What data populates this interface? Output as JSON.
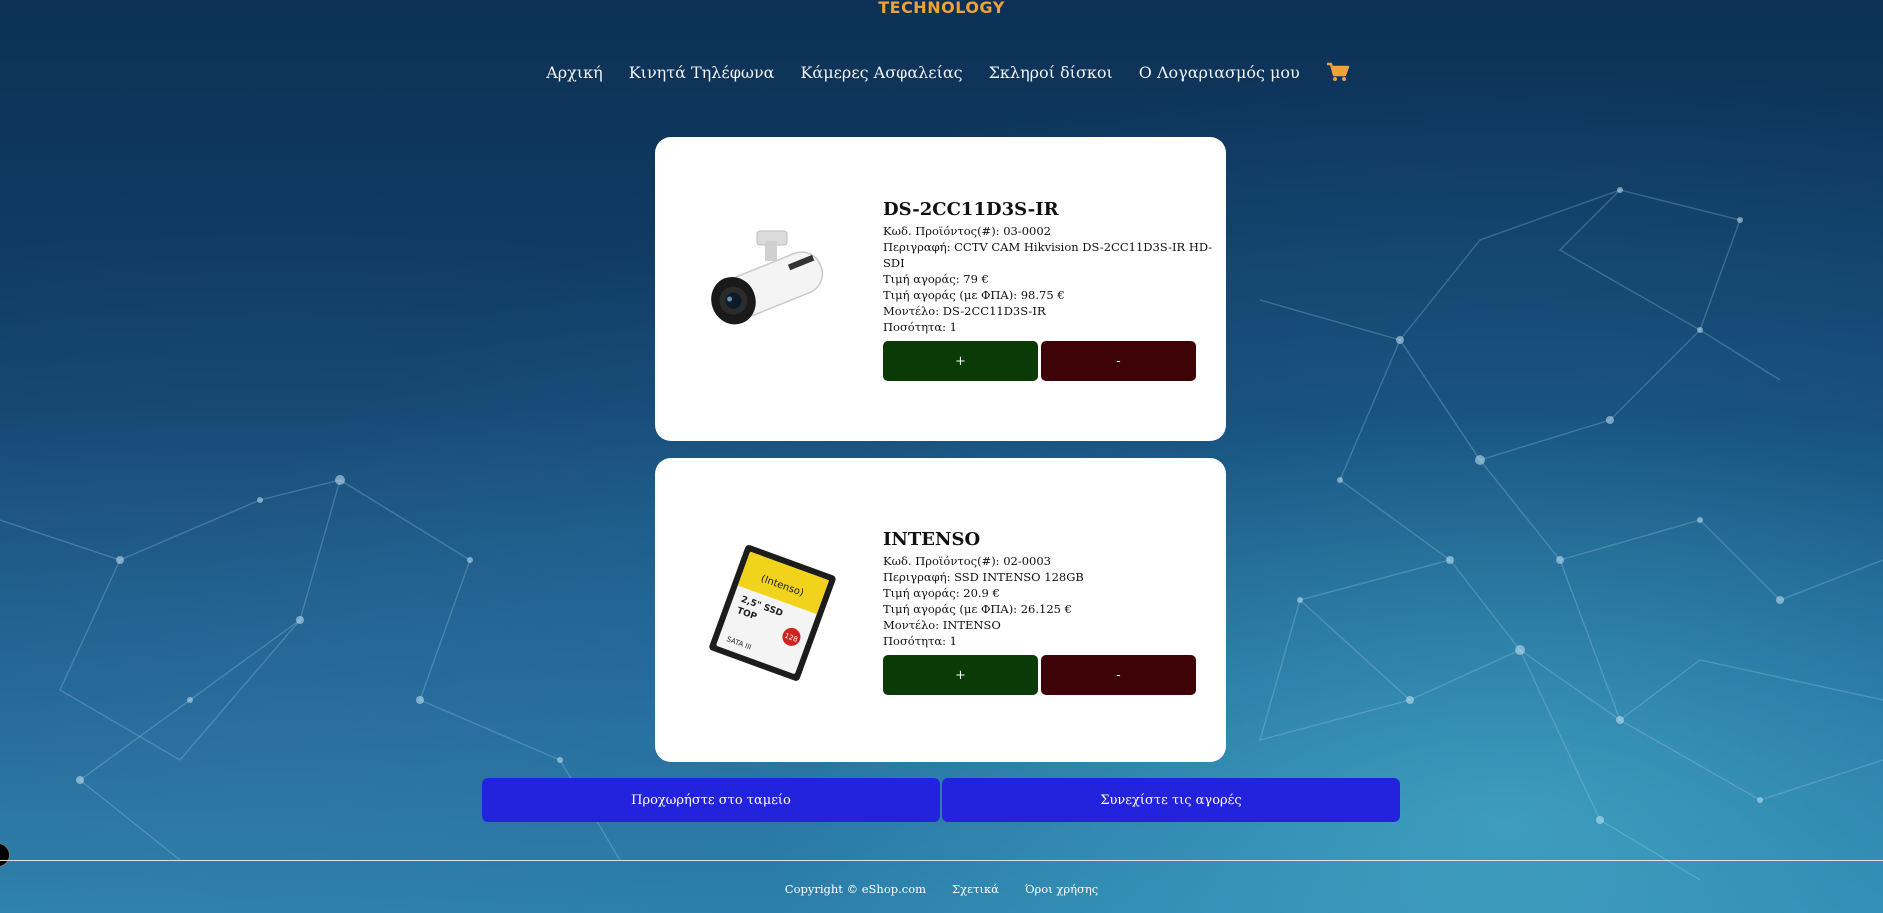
{
  "brand": {
    "logo_text": "TECHNOLOGY"
  },
  "nav": {
    "items": [
      {
        "label": "Αρχική"
      },
      {
        "label": "Κινητά Τηλέφωνα"
      },
      {
        "label": "Κάμερες Ασφαλείας"
      },
      {
        "label": "Σκληροί δίσκοι"
      },
      {
        "label": "Ο Λογαριασμός μου"
      }
    ],
    "cart_icon": "shopping-cart-icon",
    "accent": "#f0a13a"
  },
  "cart": {
    "items": [
      {
        "title": "DS-2CC11D3S-IR",
        "code": "Κωδ. Προϊόντος(#): 03-0002",
        "description": "Περιγραφή: CCTV CAM Hikvision DS-2CC11D3S-IR HD-SDI",
        "price": "Τιμή αγοράς: 79 €",
        "price_vat": "Τιμή αγοράς (με ΦΠΑ): 98.75 €",
        "model": "Μοντέλο: DS-2CC11D3S-IR",
        "quantity": "Ποσότητα: 1",
        "plus_label": "+",
        "minus_label": "-",
        "image_icon": "security-camera-image"
      },
      {
        "title": "INTENSO",
        "code": "Κωδ. Προϊόντος(#): 02-0003",
        "description": "Περιγραφή: SSD INTENSO 128GB",
        "price": "Τιμή αγοράς: 20.9 €",
        "price_vat": "Τιμή αγοράς (με ΦΠΑ): 26.125 €",
        "model": "Μοντέλο: INTENSO",
        "quantity": "Ποσότητα: 1",
        "plus_label": "+",
        "minus_label": "-",
        "image_icon": "ssd-drive-image",
        "image_text": {
          "brand": "(Intenso)",
          "size": "2,5\" SSD",
          "line": "TOP",
          "iface": "SATA III",
          "capacity": "128"
        }
      }
    ],
    "checkout_label": "Προχωρήστε στο ταμείο",
    "continue_label": "Συνεχίστε τις αγορές"
  },
  "footer": {
    "copyright": "Copyright © eShop.com",
    "about": "Σχετικά",
    "terms": "Όροι χρήσης"
  },
  "colors": {
    "plus_button": "#0a3a05",
    "minus_button": "#3d0306",
    "action_button": "#2323dd"
  }
}
